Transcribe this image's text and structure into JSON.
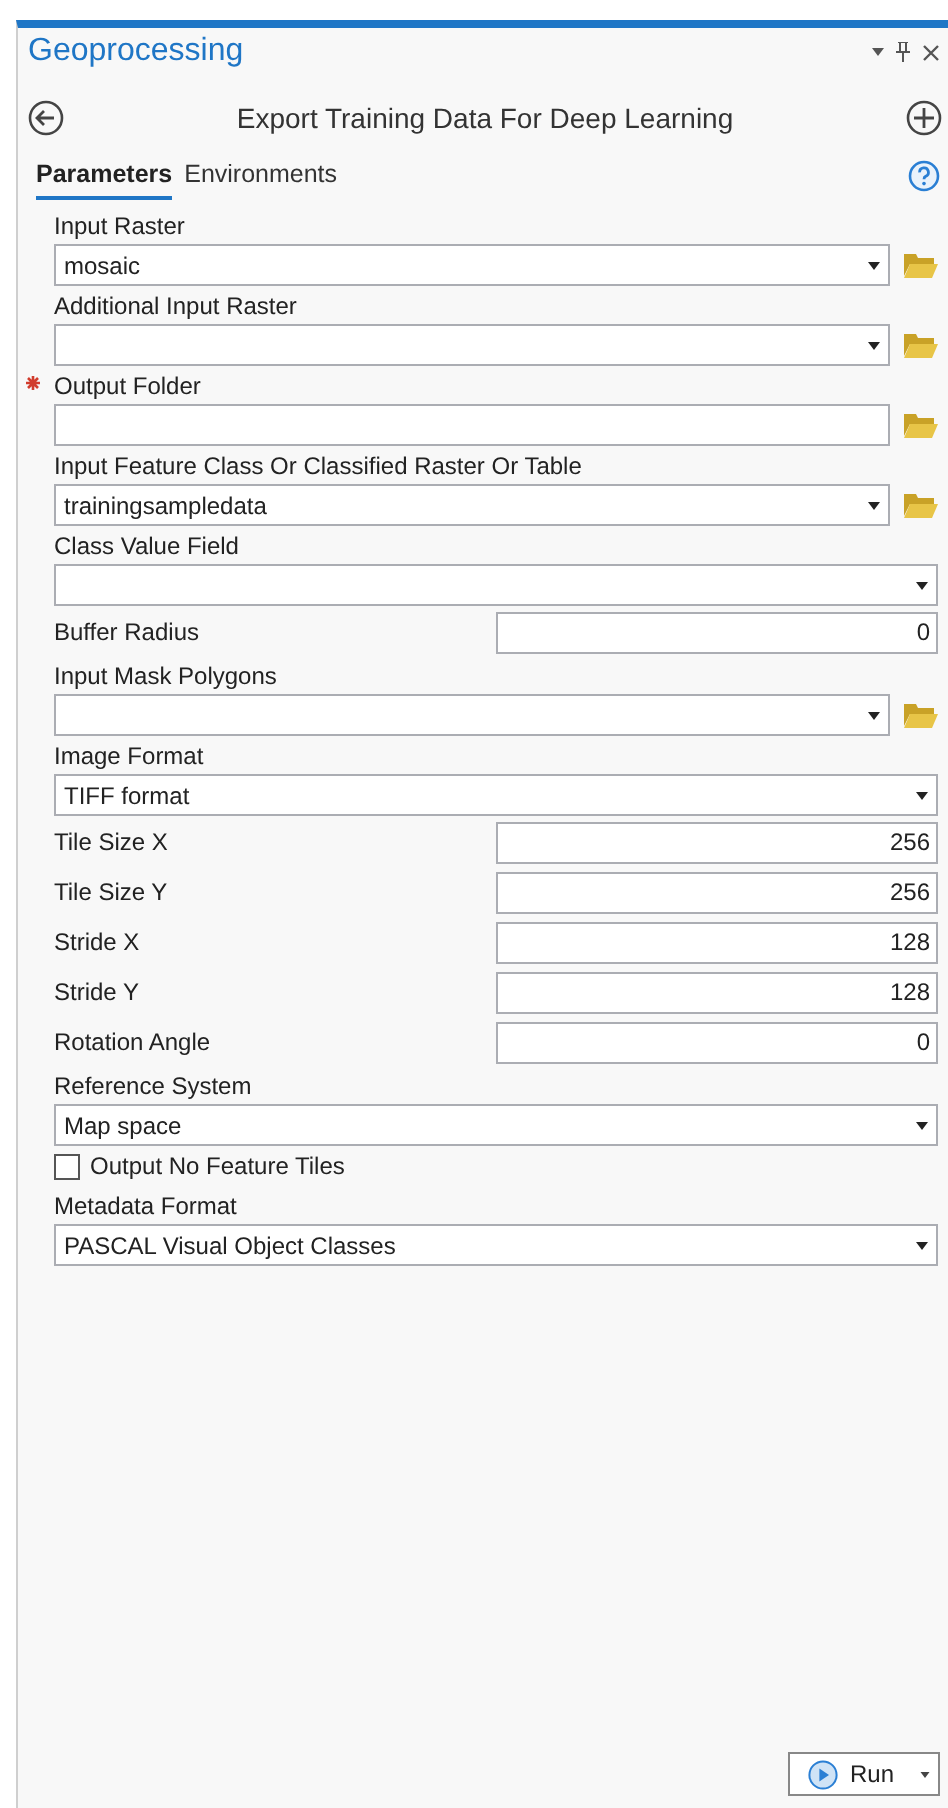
{
  "pane": {
    "title": "Geoprocessing"
  },
  "tool": {
    "title": "Export Training Data For Deep Learning"
  },
  "tabs": [
    {
      "label": "Parameters",
      "selected": true
    },
    {
      "label": "Environments",
      "selected": false
    }
  ],
  "parameters": [
    {
      "kind": "combo",
      "label": "Input Raster",
      "value": "mosaic",
      "browse": true,
      "required": false
    },
    {
      "kind": "combo",
      "label": "Additional Input Raster",
      "browse": true,
      "required": false
    },
    {
      "kind": "text",
      "label": "Output Folder",
      "browse": true,
      "required": true
    },
    {
      "kind": "combo",
      "label": "Input Feature Class Or Classified Raster Or Table",
      "value": "trainingsampledata",
      "browse": true,
      "required": false
    },
    {
      "kind": "combo",
      "label": "Class Value Field",
      "browse": false,
      "required": false
    },
    {
      "kind": "number",
      "label": "Buffer Radius",
      "value": "0"
    },
    {
      "kind": "combo",
      "label": "Input Mask Polygons",
      "browse": true,
      "required": false
    },
    {
      "kind": "combo",
      "label": "Image Format",
      "value": "TIFF format",
      "browse": false,
      "required": false
    },
    {
      "kind": "number",
      "label": "Tile Size X",
      "value": "256"
    },
    {
      "kind": "number",
      "label": "Tile Size Y",
      "value": "256"
    },
    {
      "kind": "number",
      "label": "Stride X",
      "value": "128"
    },
    {
      "kind": "number",
      "label": "Stride Y",
      "value": "128"
    },
    {
      "kind": "number",
      "label": "Rotation Angle",
      "value": "0"
    },
    {
      "kind": "combo",
      "label": "Reference System",
      "value": "Map space",
      "browse": false,
      "required": false
    },
    {
      "kind": "checkbox",
      "label": "Output No Feature Tiles",
      "checked": false
    },
    {
      "kind": "combo",
      "label": "Metadata Format",
      "value": "PASCAL Visual Object Classes",
      "browse": false,
      "required": false
    }
  ],
  "run_button": {
    "label": "Run"
  }
}
